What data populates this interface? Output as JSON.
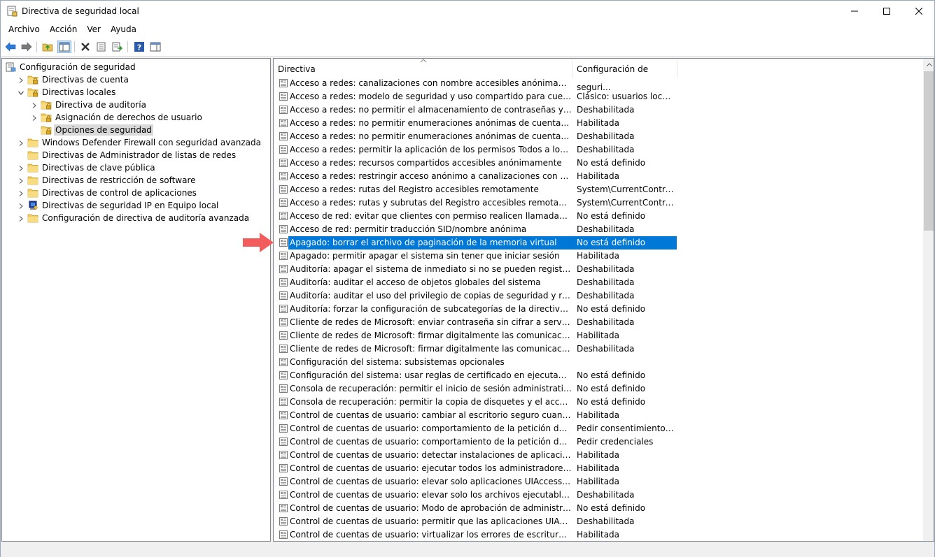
{
  "window": {
    "title": "Directiva de seguridad local"
  },
  "menu": [
    "Archivo",
    "Acción",
    "Ver",
    "Ayuda"
  ],
  "tree": [
    {
      "label": "Configuración de seguridad",
      "level": 0,
      "expand": "none",
      "icon": "computer-policy"
    },
    {
      "label": "Directivas de cuenta",
      "level": 1,
      "expand": "collapsed",
      "icon": "folder-lock"
    },
    {
      "label": "Directivas locales",
      "level": 1,
      "expand": "expanded",
      "icon": "folder-lock"
    },
    {
      "label": "Directiva de auditoría",
      "level": 2,
      "expand": "collapsed",
      "icon": "folder-lock"
    },
    {
      "label": "Asignación de derechos de usuario",
      "level": 2,
      "expand": "collapsed",
      "icon": "folder-lock"
    },
    {
      "label": "Opciones de seguridad",
      "level": 2,
      "expand": "none",
      "icon": "folder-lock",
      "selected": true
    },
    {
      "label": "Windows Defender Firewall con seguridad avanzada",
      "level": 1,
      "expand": "collapsed",
      "icon": "folder"
    },
    {
      "label": "Directivas de Administrador de listas de redes",
      "level": 1,
      "expand": "none",
      "icon": "folder"
    },
    {
      "label": "Directivas de clave pública",
      "level": 1,
      "expand": "collapsed",
      "icon": "folder"
    },
    {
      "label": "Directivas de restricción de software",
      "level": 1,
      "expand": "collapsed",
      "icon": "folder"
    },
    {
      "label": "Directivas de control de aplicaciones",
      "level": 1,
      "expand": "collapsed",
      "icon": "folder"
    },
    {
      "label": "Directivas de seguridad IP en Equipo local",
      "level": 1,
      "expand": "collapsed",
      "icon": "ip-security"
    },
    {
      "label": "Configuración de directiva de auditoría avanzada",
      "level": 1,
      "expand": "collapsed",
      "icon": "folder"
    }
  ],
  "list": {
    "columns": [
      "Directiva",
      "Configuración de seguri..."
    ],
    "rows": [
      [
        "Acceso a redes: canalizaciones con nombre accesibles anónimamente",
        ""
      ],
      [
        "Acceso a redes: modelo de seguridad y uso compartido para cuentas locales",
        "Clásico: usuarios locales..."
      ],
      [
        "Acceso a redes: no permitir el almacenamiento de contraseñas y credencia...",
        "Deshabilitada"
      ],
      [
        "Acceso a redes: no permitir enumeraciones anónimas de cuentas SAM",
        "Habilitada"
      ],
      [
        "Acceso a redes: no permitir enumeraciones anónimas de cuentas y recurso...",
        "Deshabilitada"
      ],
      [
        "Acceso a redes: permitir la aplicación de los permisos Todos a los usuarios ...",
        "Deshabilitada"
      ],
      [
        "Acceso a redes: recursos compartidos accesibles anónimamente",
        "No está definido"
      ],
      [
        "Acceso a redes: restringir acceso anónimo a canalizaciones con nombre y r...",
        "Habilitada"
      ],
      [
        "Acceso a redes: rutas del Registro accesibles remotamente",
        "System\\CurrentControlS..."
      ],
      [
        "Acceso a redes: rutas y subrutas del Registro accesibles remotamente",
        "System\\CurrentControlS..."
      ],
      [
        "Acceso de red: evitar que clientes con permiso realicen llamadas remotas a...",
        "No está definido"
      ],
      [
        "Acceso de red: permitir traducción SID/nombre anónima",
        "Deshabilitada"
      ],
      [
        "Apagado: borrar el archivo de paginación de la memoria virtual",
        "No está definido"
      ],
      [
        "Apagado: permitir apagar el sistema sin tener que iniciar sesión",
        "Habilitada"
      ],
      [
        "Auditoría: apagar el sistema de inmediato si no se pueden registrar las audi...",
        "Deshabilitada"
      ],
      [
        "Auditoría: auditar el acceso de objetos globales del sistema",
        "Deshabilitada"
      ],
      [
        "Auditoría: auditar el uso del privilegio de copias de seguridad y restauración",
        "Deshabilitada"
      ],
      [
        "Auditoría: forzar la configuración de subcategorías de la directiva de audit...",
        "No está definido"
      ],
      [
        "Cliente de redes de Microsoft: enviar contraseña sin cifrar a servidores SMB...",
        "Deshabilitada"
      ],
      [
        "Cliente de redes de Microsoft: firmar digitalmente las comunicaciones (si e...",
        "Habilitada"
      ],
      [
        "Cliente de redes de Microsoft: firmar digitalmente las comunicaciones (sie...",
        "Deshabilitada"
      ],
      [
        "Configuración del sistema: subsistemas opcionales",
        ""
      ],
      [
        "Configuración del sistema: usar reglas de certificado en ejecutables de Win...",
        "No está definido"
      ],
      [
        "Consola de recuperación: permitir el inicio de sesión administrativo autom...",
        "No está definido"
      ],
      [
        "Consola de recuperación: permitir la copia de disquetes y el acceso a todas...",
        "No está definido"
      ],
      [
        "Control de cuentas de usuario: cambiar al escritorio seguro cuando se pida...",
        "Habilitada"
      ],
      [
        "Control de cuentas de usuario: comportamiento de la petición de elevació...",
        "Pedir consentimiento pa..."
      ],
      [
        "Control de cuentas de usuario: comportamiento de la petición de elevació...",
        "Pedir credenciales"
      ],
      [
        "Control de cuentas de usuario: detectar instalaciones de aplicaciones y pe...",
        "Habilitada"
      ],
      [
        "Control de cuentas de usuario: ejecutar todos los administradores en Mod...",
        "Habilitada"
      ],
      [
        "Control de cuentas de usuario: elevar solo aplicaciones UIAccess instaladas...",
        "Habilitada"
      ],
      [
        "Control de cuentas de usuario: elevar solo los archivos ejecutables firmado...",
        "Deshabilitada"
      ],
      [
        "Control de cuentas de usuario: Modo de aprobación de administrador par...",
        "No está definido"
      ],
      [
        "Control de cuentas de usuario: permitir que las aplicaciones UIAccess pida...",
        "Deshabilitada"
      ],
      [
        "Control de cuentas de usuario: virtualizar los errores de escritura de archiv...",
        "Habilitada"
      ]
    ],
    "selected_index": 12
  },
  "colors": {
    "selection": "#0078d7",
    "tree_selection": "#d9d9d9",
    "arrow": "#f25c5c"
  }
}
